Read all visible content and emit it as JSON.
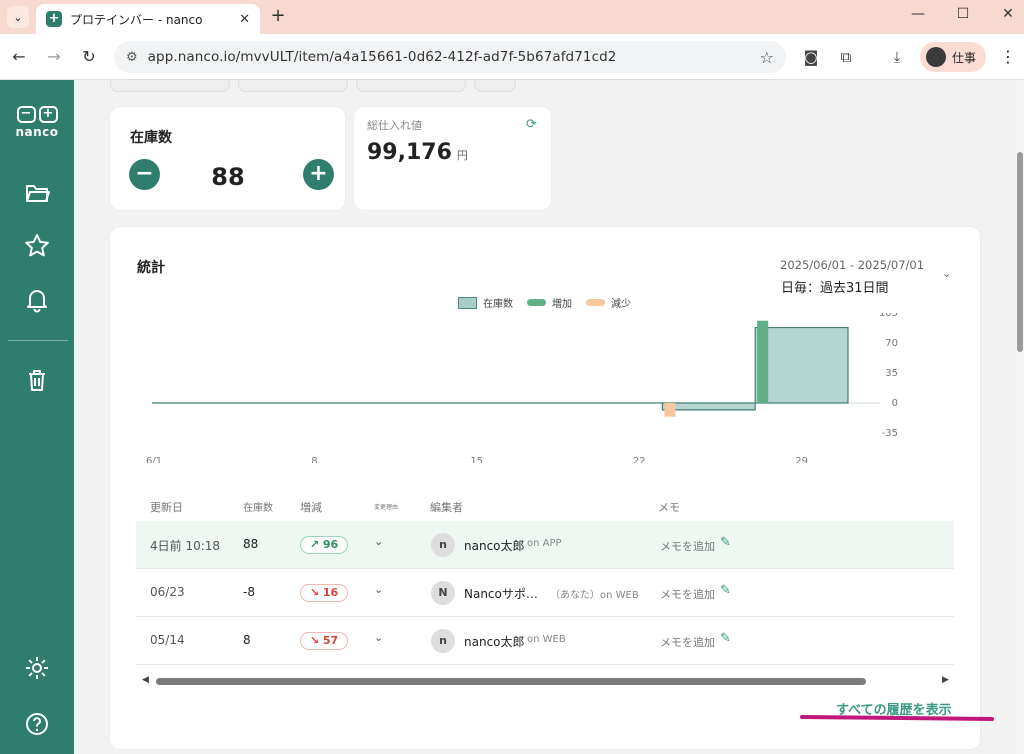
{
  "browser": {
    "tab_title": "プロテインバー - nanco",
    "url": "app.nanco.io/mvvULT/item/a4a15661-0d62-412f-ad7f-5b67afd71cd2",
    "profile_label": "仕事"
  },
  "sidebar": {
    "brand": "nanco",
    "items": [
      "folder",
      "favorites",
      "notifications",
      "trash",
      "settings",
      "help"
    ]
  },
  "stock": {
    "label": "在庫数",
    "value": "88"
  },
  "total_value": {
    "label": "総仕入れ値",
    "value": "99,176",
    "unit": "円"
  },
  "stats": {
    "title": "統計",
    "date_range": "2025/06/01 - 2025/07/01",
    "period": "日毎：過去31日間",
    "legend": [
      "在庫数",
      "増加",
      "減少"
    ]
  },
  "chart_data": {
    "type": "bar",
    "x_ticks": [
      "6/1",
      "8",
      "15",
      "22",
      "29"
    ],
    "y_ticks": [
      105,
      70,
      35,
      0,
      -35
    ],
    "ylim": [
      -35,
      105
    ],
    "series": [
      {
        "name": "在庫数",
        "type": "area-step",
        "points": [
          [
            1,
            0
          ],
          [
            22,
            0
          ],
          [
            23,
            -8
          ],
          [
            26,
            -8
          ],
          [
            27,
            88
          ],
          [
            31,
            88
          ]
        ]
      },
      {
        "name": "増加",
        "type": "bar",
        "points": [
          [
            27,
            96
          ]
        ]
      },
      {
        "name": "減少",
        "type": "bar",
        "points": [
          [
            23,
            -16
          ]
        ]
      }
    ],
    "colors": {
      "stock": "#a9cdc8",
      "increase": "#5fb087",
      "decrease": "#f7c79e"
    }
  },
  "history": {
    "headers": [
      "更新日",
      "在庫数",
      "増減",
      "変更理由",
      "編集者",
      "メモ"
    ],
    "rows": [
      {
        "date": "4日前 10:18",
        "stock": "88",
        "change": "↗ 96",
        "dir": "up",
        "avatar": "n",
        "editor": "nanco太郎",
        "via": "on APP",
        "memo": "メモを追加"
      },
      {
        "date": "06/23",
        "stock": "-8",
        "change": "↘ 16",
        "dir": "dn",
        "avatar": "N",
        "editor": "Nancoサポ…",
        "via": "（あなた）on WEB",
        "memo": "メモを追加"
      },
      {
        "date": "05/14",
        "stock": "8",
        "change": "↘ 57",
        "dir": "dn",
        "avatar": "n",
        "editor": "nanco太郎",
        "via": "on WEB",
        "memo": "メモを追加"
      }
    ],
    "show_all": "すべての履歴を表示"
  }
}
